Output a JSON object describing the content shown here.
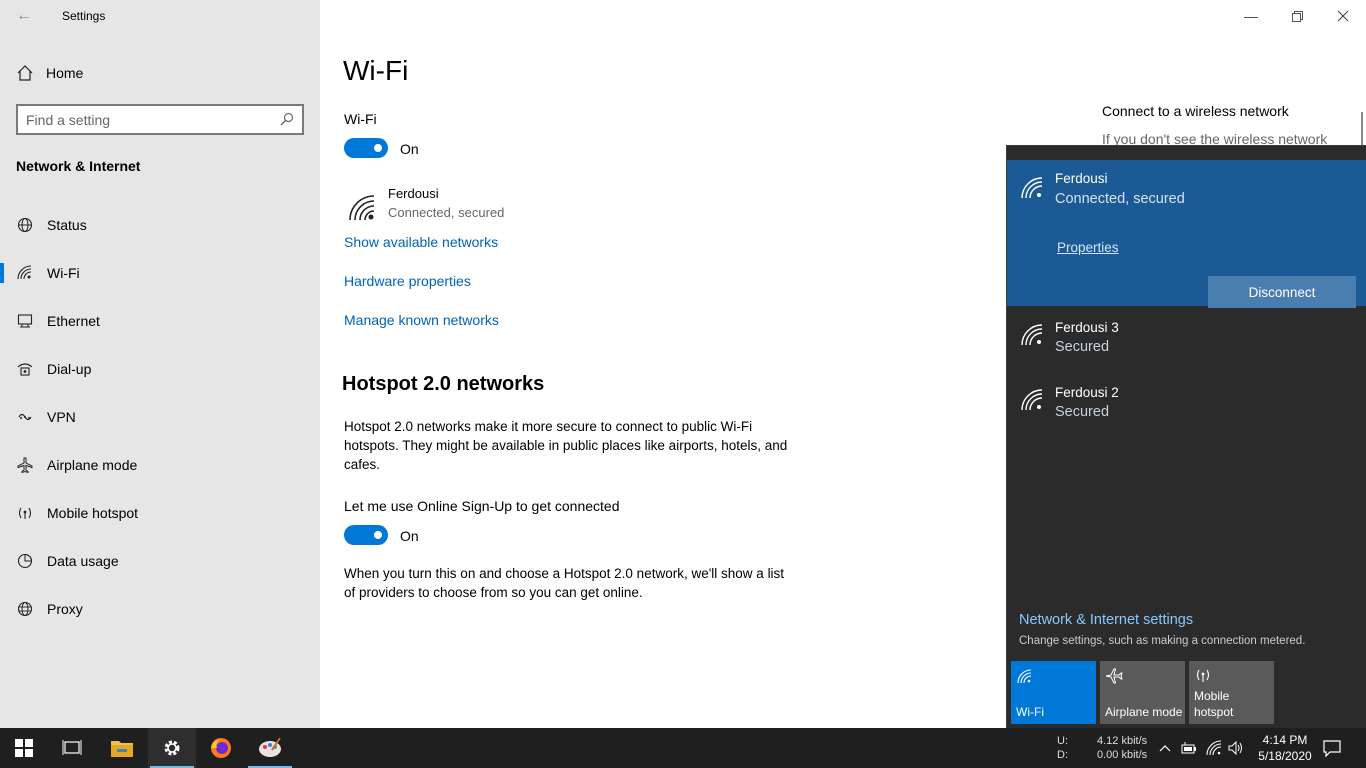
{
  "app": {
    "title": "Settings",
    "window_controls": [
      "minimize",
      "maximize",
      "close"
    ]
  },
  "sidebar": {
    "home_label": "Home",
    "search_placeholder": "Find a setting",
    "section_title": "Network & Internet",
    "items": [
      {
        "label": "Status",
        "icon": "globe-status-icon"
      },
      {
        "label": "Wi-Fi",
        "icon": "wifi-icon",
        "active": true
      },
      {
        "label": "Ethernet",
        "icon": "ethernet-icon"
      },
      {
        "label": "Dial-up",
        "icon": "dialup-icon"
      },
      {
        "label": "VPN",
        "icon": "vpn-icon"
      },
      {
        "label": "Airplane mode",
        "icon": "airplane-icon"
      },
      {
        "label": "Mobile hotspot",
        "icon": "hotspot-icon"
      },
      {
        "label": "Data usage",
        "icon": "data-usage-icon"
      },
      {
        "label": "Proxy",
        "icon": "globe-icon"
      }
    ]
  },
  "main": {
    "page_title": "Wi-Fi",
    "wifi_label": "Wi-Fi",
    "wifi_toggle_state": "On",
    "current_network": {
      "name": "Ferdousi",
      "status": "Connected, secured"
    },
    "links": {
      "show_networks": "Show available networks",
      "hardware": "Hardware properties",
      "manage": "Manage known networks"
    },
    "hotspot": {
      "title": "Hotspot 2.0 networks",
      "description": "Hotspot 2.0 networks make it more secure to connect to public Wi-Fi hotspots. They might be available in public places like airports, hotels, and cafes.",
      "signup_label": "Let me use Online Sign-Up to get connected",
      "signup_toggle_state": "On",
      "signup_description": "When you turn this on and choose a Hotspot 2.0 network, we'll show a list of providers to choose from so you can get online."
    },
    "right_panel": {
      "heading": "Connect to a wireless network",
      "subtext": "If you don't see the wireless network"
    }
  },
  "flyout": {
    "connected": {
      "name": "Ferdousi",
      "status": "Connected, secured",
      "properties": "Properties",
      "disconnect": "Disconnect"
    },
    "networks": [
      {
        "name": "Ferdousi 3",
        "status": "Secured"
      },
      {
        "name": "Ferdousi 2",
        "status": "Secured"
      }
    ],
    "settings_link": "Network & Internet settings",
    "settings_sub": "Change settings, such as making a connection metered.",
    "quick_actions": [
      {
        "label": "Wi-Fi",
        "on": true
      },
      {
        "label": "Airplane mode",
        "on": false
      },
      {
        "label": "Mobile hotspot",
        "on": false
      }
    ]
  },
  "taskbar": {
    "apps": [
      "start",
      "task-view",
      "file-explorer",
      "settings",
      "firefox",
      "paint"
    ],
    "net_speed": {
      "up_label": "U:",
      "down_label": "D:",
      "up": "4.12 kbit/s",
      "down": "0.00 kbit/s"
    },
    "time": "4:14 PM",
    "date": "5/18/2020"
  },
  "colors": {
    "accent": "#0078d7",
    "link": "#0063b1",
    "flyout_bg": "#2b2b2b",
    "flyout_selected": "#1c5a96"
  }
}
